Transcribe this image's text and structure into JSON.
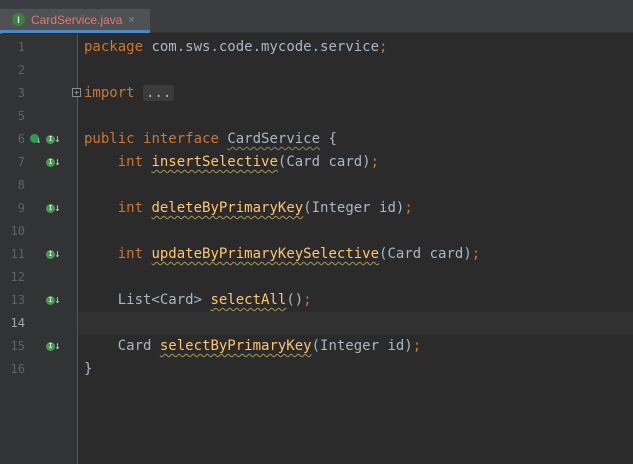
{
  "tab": {
    "icon_letter": "I",
    "title": "CardService.java",
    "close": "×"
  },
  "gutter": {
    "line_numbers": [
      "1",
      "2",
      "3",
      "5",
      "6",
      "7",
      "8",
      "9",
      "10",
      "11",
      "12",
      "13",
      "14",
      "15",
      "16"
    ],
    "current_line": "14"
  },
  "code": {
    "l1": {
      "kw": "package",
      "rest": "com.sws.code.mycode.service",
      "semi": ";"
    },
    "l3": {
      "kw": "import",
      "folded": "..."
    },
    "l6": {
      "kw1": "public",
      "kw2": "interface",
      "name": "CardService",
      "brace": "{"
    },
    "l7": {
      "type": "int",
      "name": "insertSelective",
      "args": "(Card card)",
      "semi": ";"
    },
    "l9": {
      "type": "int",
      "name": "deleteByPrimaryKey",
      "args": "(Integer id)",
      "semi": ";"
    },
    "l11": {
      "type": "int",
      "name": "updateByPrimaryKeySelective",
      "args": "(Card card)",
      "semi": ";"
    },
    "l13": {
      "type": "List<Card>",
      "name": "selectAll",
      "args": "()",
      "semi": ";"
    },
    "l15": {
      "type": "Card",
      "name": "selectByPrimaryKey",
      "args": "(Integer id)",
      "semi": ";"
    },
    "l16": {
      "brace": "}"
    }
  },
  "colors": {
    "background": "#2b2b2b",
    "keyword": "#cc7832",
    "method": "#ffc66d",
    "text": "#a9b7c6",
    "tab_title": "#e47970"
  }
}
